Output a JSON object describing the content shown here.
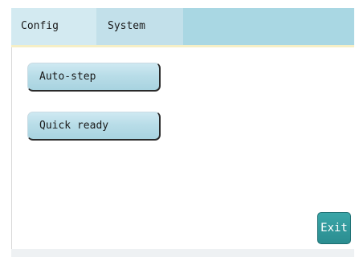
{
  "tabs": [
    {
      "label": "Config"
    },
    {
      "label": "System"
    }
  ],
  "buttons": {
    "auto_step": "Auto-step",
    "quick_ready": "Quick ready",
    "exit": "Exit"
  },
  "colors": {
    "header_bg": "#a9d7e3",
    "active_tab_bg": "#d3eaf1",
    "exit_bg": "#2b8d90"
  }
}
